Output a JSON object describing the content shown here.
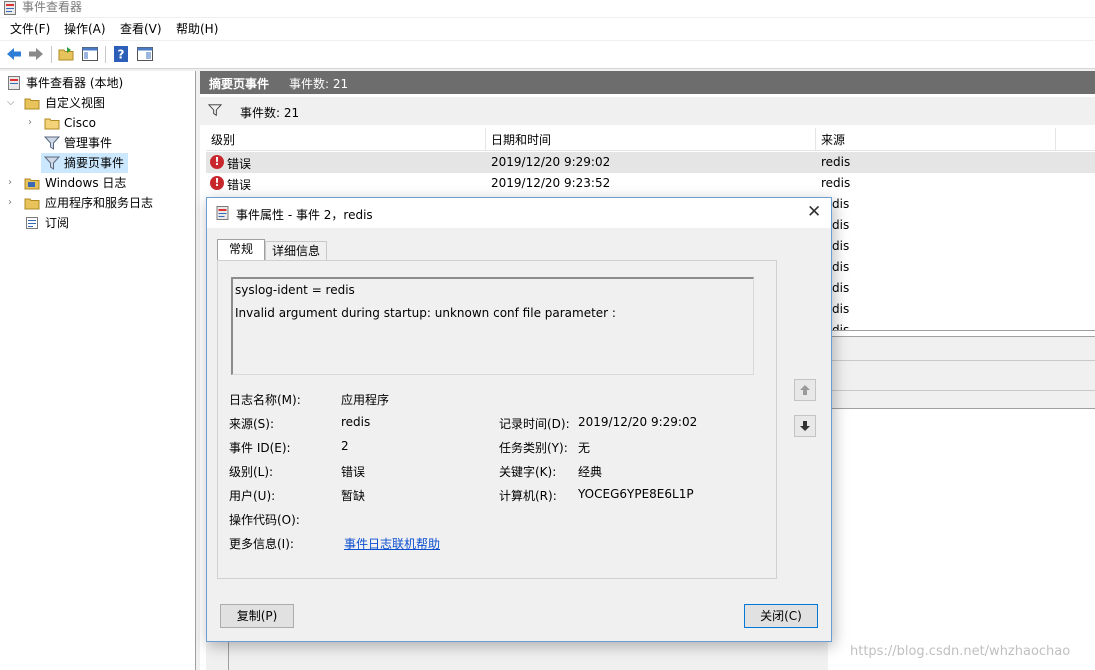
{
  "window": {
    "title": "事件查看器"
  },
  "menu": [
    "文件(F)",
    "操作(A)",
    "查看(V)",
    "帮助(H)"
  ],
  "toolbar": {
    "buttons": [
      "back-icon",
      "forward-icon",
      "open-folder-icon",
      "console-tree-icon",
      "help-icon",
      "action-pane-icon"
    ]
  },
  "tree": {
    "root": "事件查看器 (本地)",
    "custom_views": "自定义视图",
    "cisco": "Cisco",
    "admin_events": "管理事件",
    "summary_events": "摘要页事件",
    "windows_logs": "Windows 日志",
    "app_service_logs": "应用程序和服务日志",
    "subscriptions": "订阅"
  },
  "panel": {
    "title": "摘要页事件",
    "count_text": "事件数: 21",
    "filter_count_text": "事件数: 21"
  },
  "grid": {
    "columns": [
      "级别",
      "日期和时间",
      "来源"
    ],
    "rows": [
      {
        "level": "错误",
        "datetime": "2019/12/20 9:29:02",
        "source": "redis"
      },
      {
        "level": "错误",
        "datetime": "2019/12/20 9:23:52",
        "source": "redis"
      }
    ],
    "partial_sources": [
      "dis",
      "dis",
      "dis",
      "dis",
      "dis",
      "dis",
      "dis"
    ]
  },
  "dialog": {
    "title": "事件属性 - 事件 2，redis",
    "tabs": [
      "常规",
      "详细信息"
    ],
    "message_lines": [
      "syslog-ident = redis",
      "Invalid argument during startup: unknown conf file parameter :"
    ],
    "fields": {
      "log_name_label": "日志名称(M):",
      "log_name": "应用程序",
      "source_label": "来源(S):",
      "source": "redis",
      "logged_label": "记录时间(D):",
      "logged": "2019/12/20 9:29:02",
      "event_id_label": "事件 ID(E):",
      "event_id": "2",
      "task_label": "任务类别(Y):",
      "task": "无",
      "level_label": "级别(L):",
      "level": "错误",
      "keywords_label": "关键字(K):",
      "keywords": "经典",
      "user_label": "用户(U):",
      "user": "暂缺",
      "computer_label": "计算机(R):",
      "computer": "YOCEG6YPE8E6L1P",
      "opcode_label": "操作代码(O):",
      "more_info_label": "更多信息(I):",
      "more_info_link": "事件日志联机帮助"
    },
    "copy_button": "复制(P)",
    "close_button": "关闭(C)"
  },
  "watermark": "https://blog.csdn.net/whzhaochao"
}
